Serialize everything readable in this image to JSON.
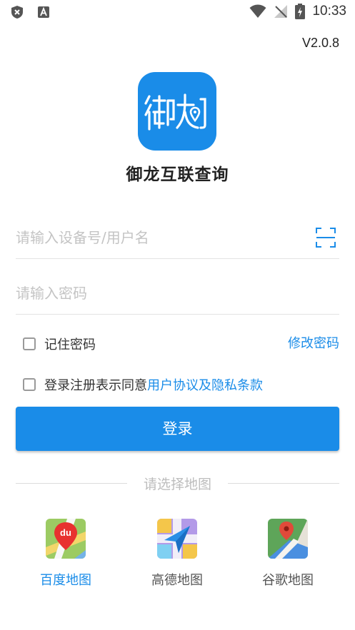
{
  "status_bar": {
    "time": "10:33"
  },
  "version": "V2.0.8",
  "app": {
    "name": "御龙互联查询"
  },
  "form": {
    "device_placeholder": "请输入设备号/用户名",
    "device_value": "",
    "password_placeholder": "请输入密码",
    "password_value": "",
    "remember_label": "记住密码",
    "remember_checked": false,
    "change_password_label": "修改密码",
    "agree_prefix": "登录注册表示同意",
    "agree_link": "用户协议及隐私条款",
    "agree_checked": false,
    "login_label": "登录"
  },
  "maps": {
    "title": "请选择地图",
    "items": [
      {
        "label": "百度地图",
        "icon": "baidu-map-icon",
        "selected": true
      },
      {
        "label": "高德地图",
        "icon": "amap-icon",
        "selected": false
      },
      {
        "label": "谷歌地图",
        "icon": "google-maps-icon",
        "selected": false
      }
    ]
  },
  "colors": {
    "accent": "#1a8ce8",
    "text": "#222222",
    "placeholder": "#c4c4c4"
  }
}
